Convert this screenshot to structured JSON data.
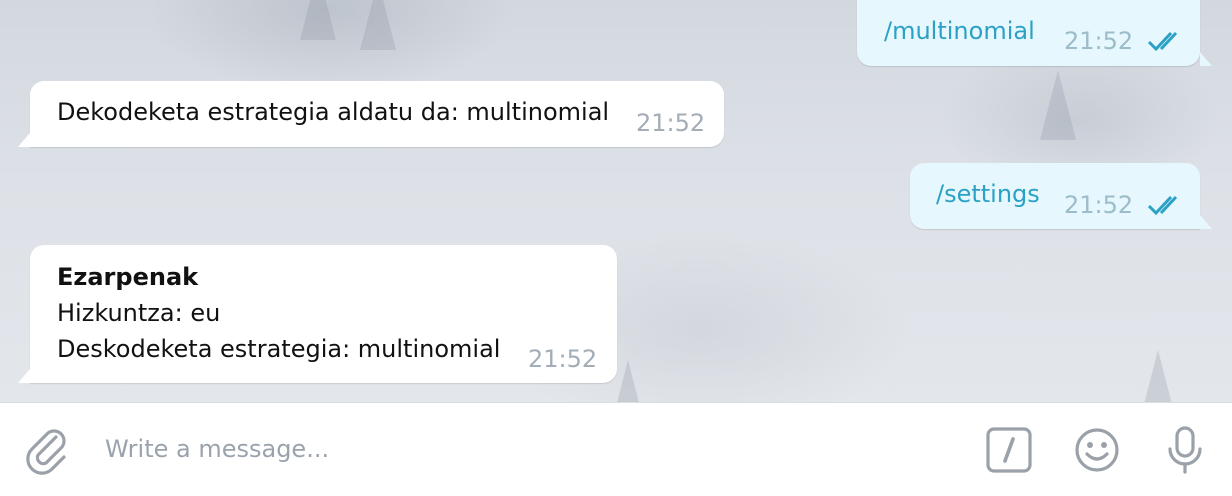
{
  "messages": [
    {
      "direction": "out",
      "text": "/multinomial",
      "time": "21:52",
      "status": "read"
    },
    {
      "direction": "in",
      "text": "Dekodeketa estrategia aldatu da: multinomial",
      "time": "21:52"
    },
    {
      "direction": "out",
      "text": "/settings",
      "time": "21:52",
      "status": "read"
    },
    {
      "direction": "in",
      "title": "Ezarpenak",
      "lines": [
        "Hizkuntza: eu",
        "Deskodeketa estrategia: multinomial"
      ],
      "time": "21:52"
    }
  ],
  "composer": {
    "placeholder": "Write a message...",
    "icons": [
      "paperclip-icon",
      "slash-command-icon",
      "emoji-icon",
      "microphone-icon"
    ]
  },
  "colors": {
    "outgoing_bubble": "#e6f7fd",
    "incoming_bubble": "#ffffff",
    "command_text": "#2aa1c5",
    "read_check": "#2aa1c5"
  }
}
